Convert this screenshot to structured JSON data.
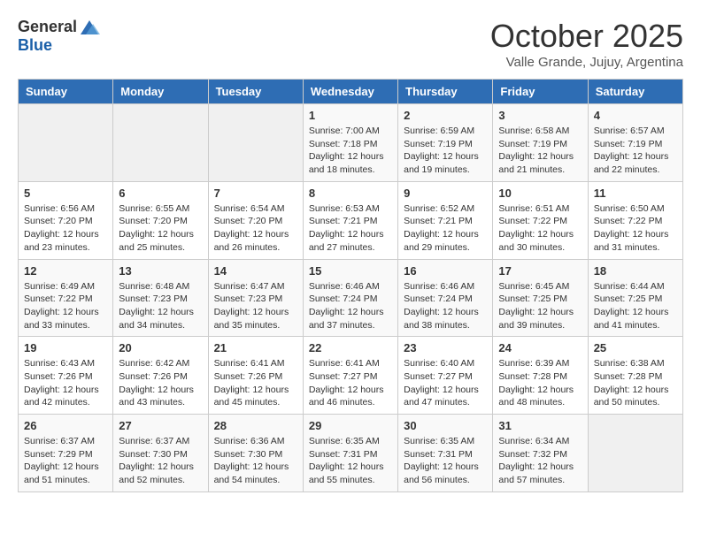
{
  "header": {
    "logo_general": "General",
    "logo_blue": "Blue",
    "month_title": "October 2025",
    "subtitle": "Valle Grande, Jujuy, Argentina"
  },
  "weekdays": [
    "Sunday",
    "Monday",
    "Tuesday",
    "Wednesday",
    "Thursday",
    "Friday",
    "Saturday"
  ],
  "weeks": [
    [
      {
        "day": "",
        "info": ""
      },
      {
        "day": "",
        "info": ""
      },
      {
        "day": "",
        "info": ""
      },
      {
        "day": "1",
        "info": "Sunrise: 7:00 AM\nSunset: 7:18 PM\nDaylight: 12 hours\nand 18 minutes."
      },
      {
        "day": "2",
        "info": "Sunrise: 6:59 AM\nSunset: 7:19 PM\nDaylight: 12 hours\nand 19 minutes."
      },
      {
        "day": "3",
        "info": "Sunrise: 6:58 AM\nSunset: 7:19 PM\nDaylight: 12 hours\nand 21 minutes."
      },
      {
        "day": "4",
        "info": "Sunrise: 6:57 AM\nSunset: 7:19 PM\nDaylight: 12 hours\nand 22 minutes."
      }
    ],
    [
      {
        "day": "5",
        "info": "Sunrise: 6:56 AM\nSunset: 7:20 PM\nDaylight: 12 hours\nand 23 minutes."
      },
      {
        "day": "6",
        "info": "Sunrise: 6:55 AM\nSunset: 7:20 PM\nDaylight: 12 hours\nand 25 minutes."
      },
      {
        "day": "7",
        "info": "Sunrise: 6:54 AM\nSunset: 7:20 PM\nDaylight: 12 hours\nand 26 minutes."
      },
      {
        "day": "8",
        "info": "Sunrise: 6:53 AM\nSunset: 7:21 PM\nDaylight: 12 hours\nand 27 minutes."
      },
      {
        "day": "9",
        "info": "Sunrise: 6:52 AM\nSunset: 7:21 PM\nDaylight: 12 hours\nand 29 minutes."
      },
      {
        "day": "10",
        "info": "Sunrise: 6:51 AM\nSunset: 7:22 PM\nDaylight: 12 hours\nand 30 minutes."
      },
      {
        "day": "11",
        "info": "Sunrise: 6:50 AM\nSunset: 7:22 PM\nDaylight: 12 hours\nand 31 minutes."
      }
    ],
    [
      {
        "day": "12",
        "info": "Sunrise: 6:49 AM\nSunset: 7:22 PM\nDaylight: 12 hours\nand 33 minutes."
      },
      {
        "day": "13",
        "info": "Sunrise: 6:48 AM\nSunset: 7:23 PM\nDaylight: 12 hours\nand 34 minutes."
      },
      {
        "day": "14",
        "info": "Sunrise: 6:47 AM\nSunset: 7:23 PM\nDaylight: 12 hours\nand 35 minutes."
      },
      {
        "day": "15",
        "info": "Sunrise: 6:46 AM\nSunset: 7:24 PM\nDaylight: 12 hours\nand 37 minutes."
      },
      {
        "day": "16",
        "info": "Sunrise: 6:46 AM\nSunset: 7:24 PM\nDaylight: 12 hours\nand 38 minutes."
      },
      {
        "day": "17",
        "info": "Sunrise: 6:45 AM\nSunset: 7:25 PM\nDaylight: 12 hours\nand 39 minutes."
      },
      {
        "day": "18",
        "info": "Sunrise: 6:44 AM\nSunset: 7:25 PM\nDaylight: 12 hours\nand 41 minutes."
      }
    ],
    [
      {
        "day": "19",
        "info": "Sunrise: 6:43 AM\nSunset: 7:26 PM\nDaylight: 12 hours\nand 42 minutes."
      },
      {
        "day": "20",
        "info": "Sunrise: 6:42 AM\nSunset: 7:26 PM\nDaylight: 12 hours\nand 43 minutes."
      },
      {
        "day": "21",
        "info": "Sunrise: 6:41 AM\nSunset: 7:26 PM\nDaylight: 12 hours\nand 45 minutes."
      },
      {
        "day": "22",
        "info": "Sunrise: 6:41 AM\nSunset: 7:27 PM\nDaylight: 12 hours\nand 46 minutes."
      },
      {
        "day": "23",
        "info": "Sunrise: 6:40 AM\nSunset: 7:27 PM\nDaylight: 12 hours\nand 47 minutes."
      },
      {
        "day": "24",
        "info": "Sunrise: 6:39 AM\nSunset: 7:28 PM\nDaylight: 12 hours\nand 48 minutes."
      },
      {
        "day": "25",
        "info": "Sunrise: 6:38 AM\nSunset: 7:28 PM\nDaylight: 12 hours\nand 50 minutes."
      }
    ],
    [
      {
        "day": "26",
        "info": "Sunrise: 6:37 AM\nSunset: 7:29 PM\nDaylight: 12 hours\nand 51 minutes."
      },
      {
        "day": "27",
        "info": "Sunrise: 6:37 AM\nSunset: 7:30 PM\nDaylight: 12 hours\nand 52 minutes."
      },
      {
        "day": "28",
        "info": "Sunrise: 6:36 AM\nSunset: 7:30 PM\nDaylight: 12 hours\nand 54 minutes."
      },
      {
        "day": "29",
        "info": "Sunrise: 6:35 AM\nSunset: 7:31 PM\nDaylight: 12 hours\nand 55 minutes."
      },
      {
        "day": "30",
        "info": "Sunrise: 6:35 AM\nSunset: 7:31 PM\nDaylight: 12 hours\nand 56 minutes."
      },
      {
        "day": "31",
        "info": "Sunrise: 6:34 AM\nSunset: 7:32 PM\nDaylight: 12 hours\nand 57 minutes."
      },
      {
        "day": "",
        "info": ""
      }
    ]
  ],
  "colors": {
    "header_bg": "#2e6db4",
    "logo_blue": "#1a5fa8"
  }
}
